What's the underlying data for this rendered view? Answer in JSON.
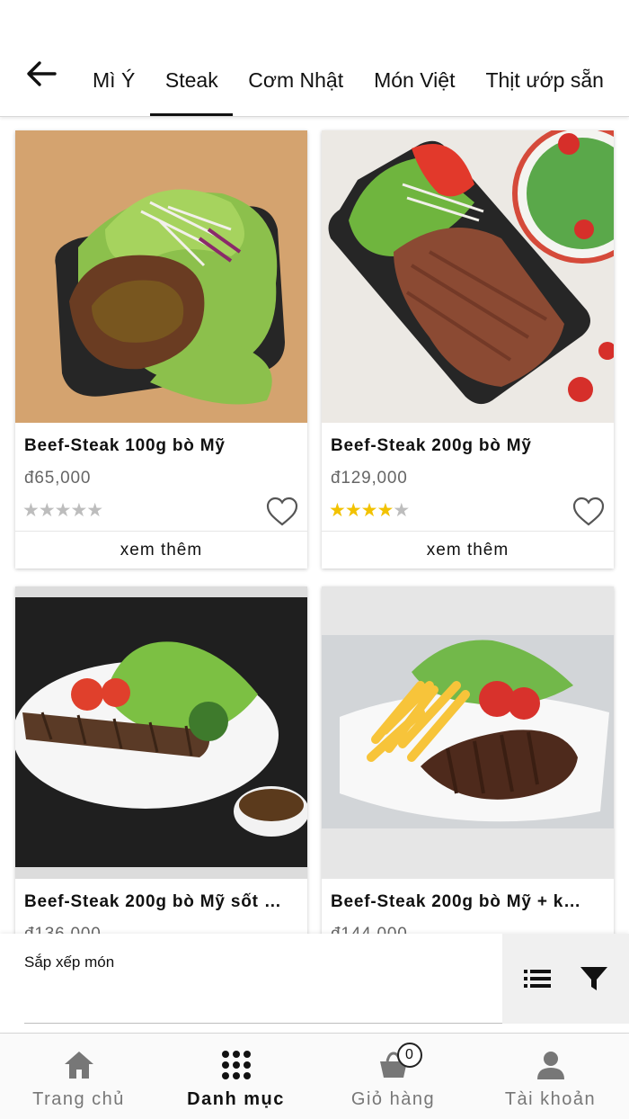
{
  "header": {
    "tabs": [
      {
        "label": "Mì Ý"
      },
      {
        "label": "Steak"
      },
      {
        "label": "Cơm Nhật"
      },
      {
        "label": "Món Việt"
      },
      {
        "label": "Thịt ướp sẵn"
      }
    ],
    "active_tab": "Steak"
  },
  "products": [
    {
      "name": "Beef-Steak 100g bò Mỹ",
      "price": "đ65,000",
      "rating": 0,
      "stars": "★★★★★",
      "more_label": "xem thêm"
    },
    {
      "name": "Beef-Steak 200g bò Mỹ",
      "price": "đ129,000",
      "rating": 4,
      "stars": "★★★★★",
      "more_label": "xem thêm"
    },
    {
      "name": "Beef-Steak 200g bò Mỹ sốt …",
      "price": "đ136,000"
    },
    {
      "name": "Beef-Steak 200g bò Mỹ + k…",
      "price": "đ144,000"
    }
  ],
  "sort": {
    "label": "Sắp xếp món"
  },
  "bottom_nav": {
    "items": [
      {
        "label": "Trang chủ"
      },
      {
        "label": "Danh mục"
      },
      {
        "label": "Giỏ hàng"
      },
      {
        "label": "Tài khoản"
      }
    ],
    "active": "Danh mục",
    "cart_count": "0"
  },
  "colors": {
    "star_on": "#f2c200",
    "star_off": "#bdbdbd",
    "sort_actions_bg": "#f0f0f0"
  }
}
